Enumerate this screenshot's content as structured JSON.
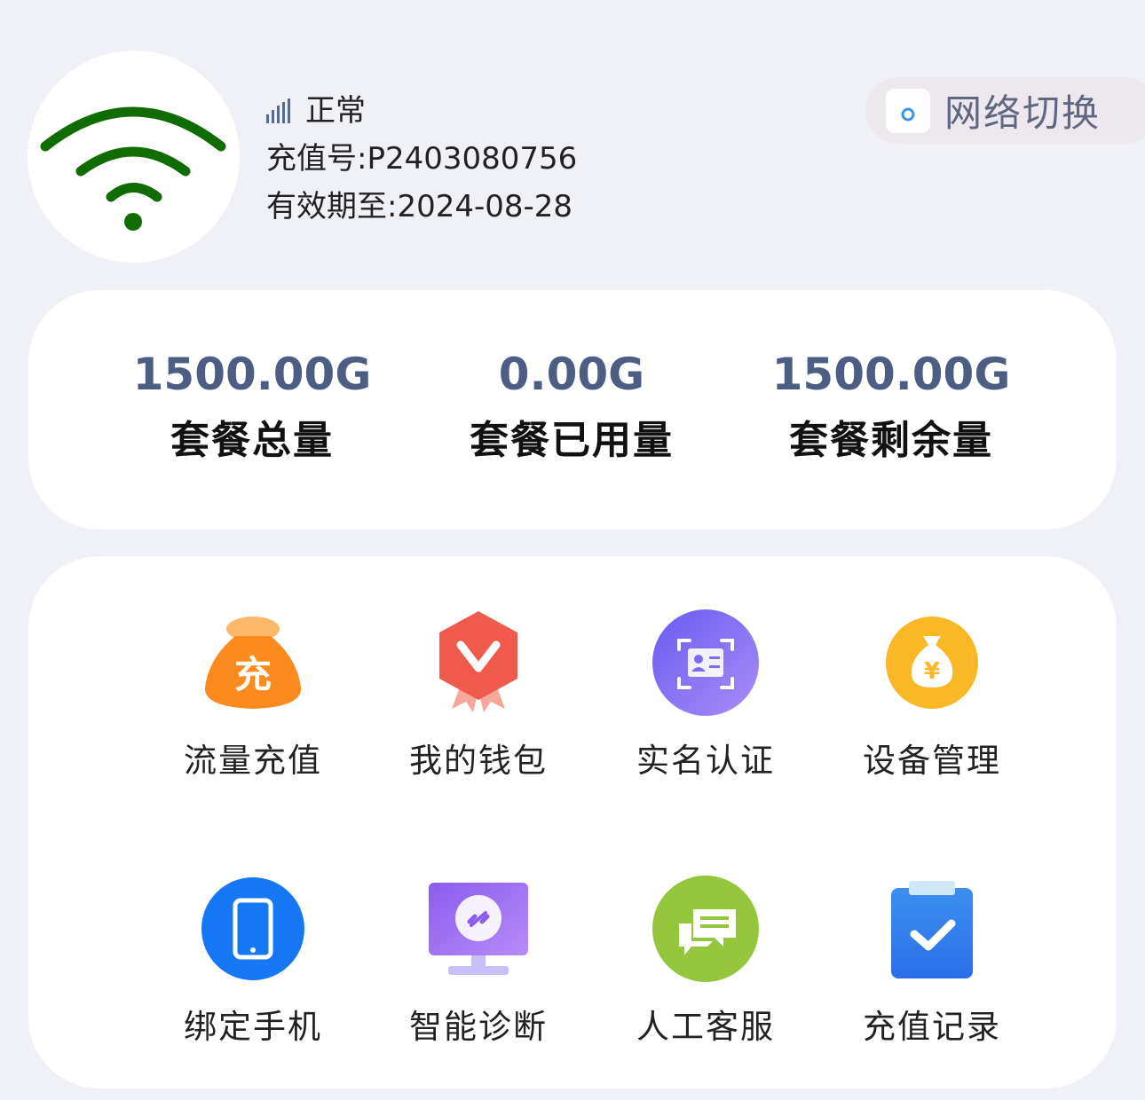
{
  "device": {
    "status": "正常",
    "recharge_id": "充值号:P2403080756",
    "expiry": "有效期至:2024-08-28",
    "wifi_color": "#106b00"
  },
  "network_switch": {
    "label": "网络切换"
  },
  "stats": [
    {
      "value": "1500.00G",
      "label": "套餐总量"
    },
    {
      "value": "0.00G",
      "label": "套餐已用量"
    },
    {
      "value": "1500.00G",
      "label": "套餐剩余量"
    }
  ],
  "menu": [
    {
      "label": "流量充值",
      "icon": "recharge-bag-icon",
      "color": "#fb8b1e"
    },
    {
      "label": "我的钱包",
      "icon": "wallet-badge-icon",
      "color": "#ef5a4c"
    },
    {
      "label": "实名认证",
      "icon": "id-card-icon",
      "color": "#7c6cf4"
    },
    {
      "label": "设备管理",
      "icon": "money-bag-icon",
      "color": "#fbb826"
    },
    {
      "label": "绑定手机",
      "icon": "phone-icon",
      "color": "#1677f5"
    },
    {
      "label": "智能诊断",
      "icon": "monitor-link-icon",
      "color": "#9c68f2"
    },
    {
      "label": "人工客服",
      "icon": "chat-icon",
      "color": "#94c73d"
    },
    {
      "label": "充值记录",
      "icon": "clipboard-check-icon",
      "color": "#3d8ff0"
    }
  ]
}
